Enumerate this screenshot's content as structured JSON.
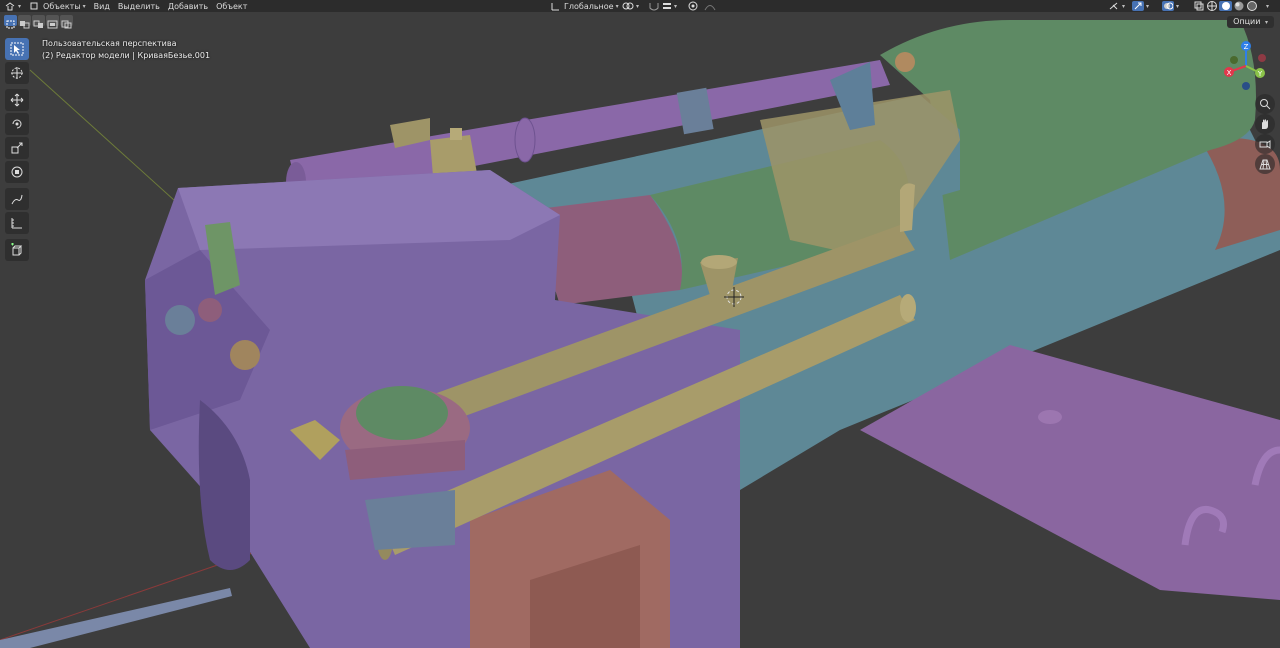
{
  "header": {
    "objects_mode_label": "Объекты",
    "menu": {
      "view": "Вид",
      "select": "Выделить",
      "add": "Добавить",
      "object": "Объект"
    },
    "transform_orientation": "Глобальное"
  },
  "subbar": {
    "options_label": "Опции"
  },
  "viewport_info": {
    "perspective_label": "Пользовательская перспектива",
    "object_label": "(2) Редактор модели | КриваяБезье.001"
  },
  "gizmo": {
    "x_label": "X",
    "y_label": "Y",
    "z_label": "Z",
    "x_color": "#e2374c",
    "y_color": "#8bc34a",
    "z_color": "#2f7fe8"
  },
  "colors": {
    "background": "#3d3d3d",
    "purple": "#7a66a3",
    "teal": "#5e8896",
    "green": "#5e8a64",
    "olive": "#9e9467",
    "pink": "#8e5e7b",
    "salmon": "#a06a62",
    "active_blue": "#4772b3"
  }
}
